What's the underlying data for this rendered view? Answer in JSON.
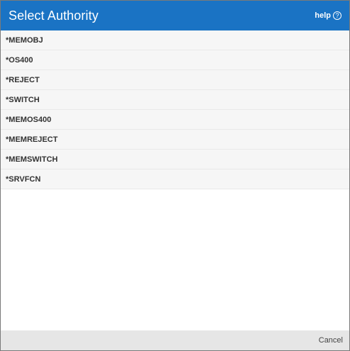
{
  "dialog": {
    "title": "Select Authority",
    "help_label": "help",
    "help_icon": "?",
    "cancel_label": "Cancel"
  },
  "authorities": [
    "*MEMOBJ",
    "*OS400",
    "*REJECT",
    "*SWITCH",
    "*MEMOS400",
    "*MEMREJECT",
    "*MEMSWITCH",
    "*SRVFCN"
  ],
  "colors": {
    "header": "#1a73c4",
    "list_row": "#f6f6f6",
    "footer": "#e6e6e6"
  }
}
